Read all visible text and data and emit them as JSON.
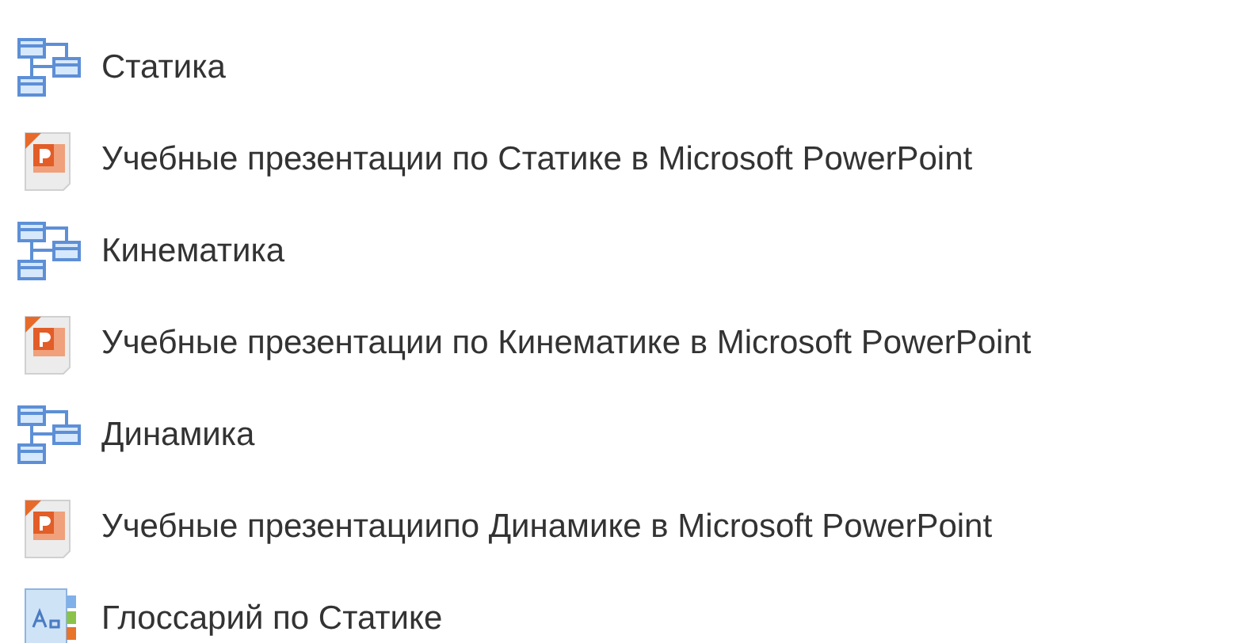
{
  "items": [
    {
      "kind": "folder",
      "label": "Статика"
    },
    {
      "kind": "presentation",
      "label": "Учебные презентации по Статике в Microsoft PowerPoint"
    },
    {
      "kind": "folder",
      "label": "Кинематика"
    },
    {
      "kind": "presentation",
      "label": "Учебные презентации по Кинематике в Microsoft PowerPoint"
    },
    {
      "kind": "folder",
      "label": "Динамика"
    },
    {
      "kind": "presentation",
      "label": "Учебные презентациипо Динамике в Microsoft PowerPoint"
    },
    {
      "kind": "glossary",
      "label": "Глоссарий по Статике"
    }
  ]
}
